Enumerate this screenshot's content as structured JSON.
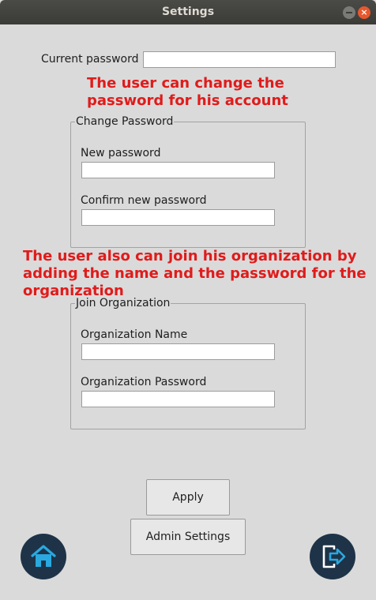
{
  "window": {
    "title": "Settings",
    "close_glyph": "×"
  },
  "current_password": {
    "label": "Current password",
    "value": ""
  },
  "note_change": {
    "line1": "The user can change the",
    "line2": "password for his account"
  },
  "change_password": {
    "title": "Change Password",
    "new_label": "New password",
    "new_value": "",
    "confirm_label": "Confirm new password",
    "confirm_value": ""
  },
  "note_join": {
    "line1": "The user also can join his organization by",
    "line2": "adding the name and the password for the",
    "line3": "organization"
  },
  "join_org": {
    "title": "Join Organization",
    "name_label": "Organization Name",
    "name_value": "",
    "password_label": "Organization Password",
    "password_value": ""
  },
  "buttons": {
    "apply": "Apply",
    "admin_settings": "Admin Settings"
  },
  "icons": {
    "home": "home-icon",
    "logout": "logout-icon"
  },
  "colors": {
    "accent_icon": "#29a9e0",
    "icon_bg": "#1e3348",
    "annotation": "#e01b1b"
  }
}
